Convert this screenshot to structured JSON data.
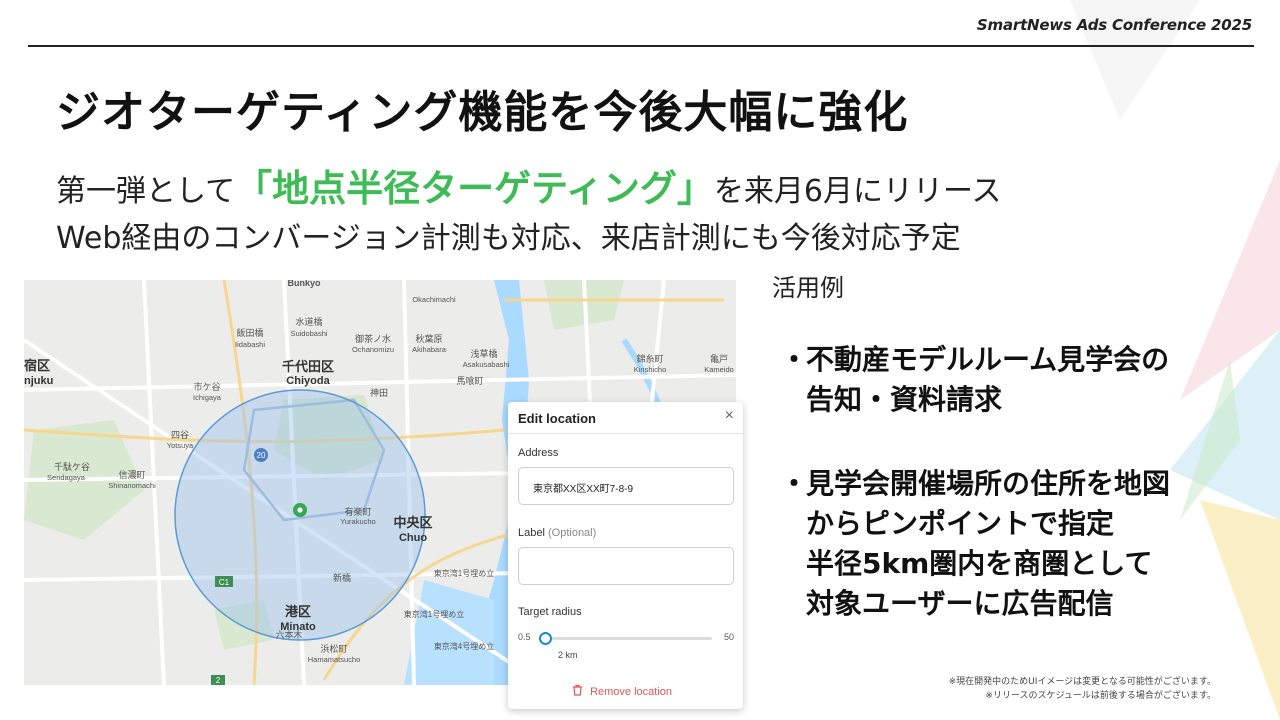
{
  "header": {
    "conference": "SmartNews Ads Conference 2025"
  },
  "slide": {
    "title": "ジオターゲティング機能を今後大幅に強化",
    "subtitle1_before": "第一弾として",
    "subtitle1_highlight": "「地点半径ターゲティング」",
    "subtitle1_after": "を来月6月にリリース",
    "subtitle2": "Web経由のコンバージョン計測も対応、来店計測にも今後対応予定"
  },
  "map": {
    "labels": {
      "bunkyo": "Bunkyo",
      "suido_jp": "水道橋",
      "suido_en": "Suidobashi",
      "chiyoda_jp": "千代田区",
      "chiyoda_en": "Chiyoda",
      "shinjuku_jp": "宿区",
      "shinjuku_en": "njuku",
      "ichigaya_jp": "市ケ谷",
      "ichigaya_en": "Ichigaya",
      "yotsuya_jp": "四谷",
      "yotsuya_en": "Yotsuya",
      "sendagaya_jp": "千駄ケ谷",
      "sendagaya_en": "Sendagaya",
      "shinanomachi_jp": "信濃町",
      "shinanomachi_en": "Shinanomachi",
      "iidabashi_jp": "飯田橋",
      "iidabashi_en": "Iidabashi",
      "ochanomizu_jp": "御茶ノ水",
      "ochanomizu_en": "Ochanomizu",
      "akihabara_jp": "秋葉原",
      "akihabara_en": "Akihabara",
      "okachimachi_en": "Okachimachi",
      "asakusabashi_jp": "浅草橋",
      "asakusabashi_en": "Asakusabashi",
      "bakurocho_jp": "馬喰町",
      "kinshicho_jp": "錦糸町",
      "kinshicho_en": "Kinshicho",
      "kameido_jp": "亀戸",
      "kameido_en": "Kameido",
      "kanda_jp": "神田",
      "yurakucho_jp": "有楽町",
      "yurakucho_en": "Yurakucho",
      "shinbashi_jp": "新橋",
      "chuo_jp": "中央区",
      "chuo_en": "Chuo",
      "minato_jp": "港区",
      "minato_en": "Minato",
      "roppongi_jp": "六本木",
      "hamamatsucho_jp": "浜松町",
      "hamamatsucho_en": "Hamamatsucho",
      "tokyo_bay_1": "東京湾1号埋め立",
      "tokyo_bay_2": "東京湾1号埋め立",
      "tokyo_bay_3": "東京湾4号埋め立",
      "route_20": "20",
      "route_c1": "C1",
      "route_2": "2"
    }
  },
  "panel": {
    "title": "Edit location",
    "close": "×",
    "address_label": "Address",
    "address_value": "東京都XX区XX町7-8-9",
    "label_label": "Label",
    "label_optional": "(Optional)",
    "label_value": "",
    "radius_label": "Target radius",
    "radius_min": "0.5",
    "radius_max": "50",
    "radius_value": "2 km",
    "radius_km": 2,
    "remove": "Remove location",
    "remove_icon": "trash-icon"
  },
  "uses": {
    "heading": "活用例",
    "bullets": [
      {
        "marker": "・",
        "lines": [
          "不動産モデルルーム見学会の",
          "告知・資料請求"
        ]
      },
      {
        "marker": "・",
        "lines": [
          "見学会開催場所の住所を地図",
          "からピンポイントで指定",
          "半径5km圏内を商圏として",
          "対象ユーザーに広告配信"
        ]
      }
    ]
  },
  "notes": [
    "※現在開発中のためUIイメージは変更となる可能性がございます。",
    "※リリースのスケジュールは前後する場合がございます。"
  ],
  "colors": {
    "highlight": "#3dbb55",
    "accent_blue": "#1a88d8",
    "remove_red": "#e05555",
    "radius_fill": "#9cc4ec"
  }
}
